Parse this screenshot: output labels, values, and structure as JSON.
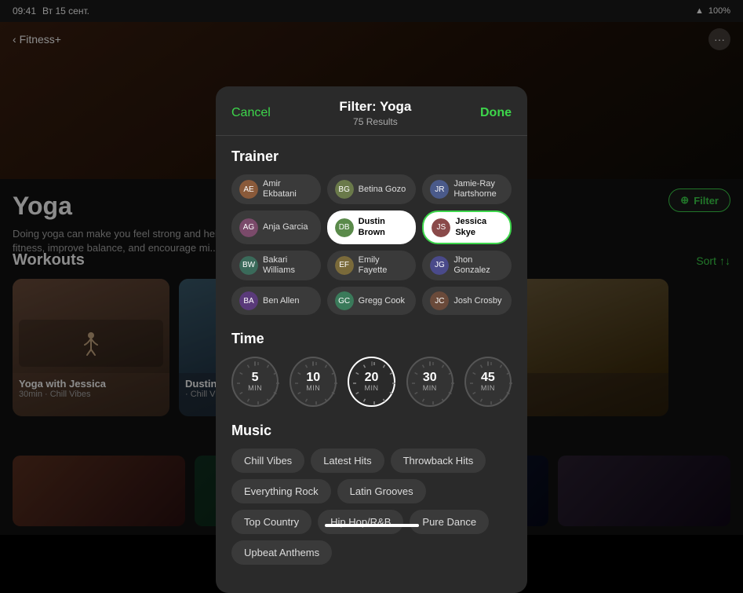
{
  "statusBar": {
    "time": "09:41",
    "date": "Вт 15 сент.",
    "signal": "●●●●",
    "wifi": "wifi",
    "battery": "100%"
  },
  "nav": {
    "back_label": "Fitness+",
    "more_icon": "···"
  },
  "yoga": {
    "title": "Yoga",
    "description": "Doing yoga can make you feel strong and help you increase overall fitness, improve balance, and encourage mi...",
    "filter_label": "Filter",
    "workouts_label": "Workouts",
    "sort_label": "Sort"
  },
  "modal": {
    "cancel_label": "Cancel",
    "title": "Filter: Yoga",
    "subtitle": "75 Results",
    "done_label": "Done",
    "trainer_section": "Trainer",
    "time_section": "Time",
    "music_section": "Music",
    "trainers": [
      {
        "name": "Amir Ekbatani",
        "color": "#8a5a3a",
        "initials": "AE",
        "selected": false
      },
      {
        "name": "Betina Gozo",
        "color": "#6a7a4a",
        "initials": "BG",
        "selected": false
      },
      {
        "name": "Jamie-Ray Hartshorne",
        "color": "#4a5a8a",
        "initials": "JR",
        "selected": false
      },
      {
        "name": "Anja Garcia",
        "color": "#7a4a6a",
        "initials": "AG",
        "selected": false
      },
      {
        "name": "Dustin Brown",
        "color": "#5a8a4a",
        "initials": "DB",
        "selected": true
      },
      {
        "name": "Jessica Skye",
        "color": "#8a4a4a",
        "initials": "JS",
        "selected": true,
        "highlighted": true
      },
      {
        "name": "Bakari Williams",
        "color": "#3a6a5a",
        "initials": "BW",
        "selected": false
      },
      {
        "name": "Emily Fayette",
        "color": "#7a6a3a",
        "initials": "EF",
        "selected": false
      },
      {
        "name": "Jhon Gonzalez",
        "color": "#4a4a8a",
        "initials": "JG",
        "selected": false
      },
      {
        "name": "Ben Allen",
        "color": "#5a3a7a",
        "initials": "BA",
        "selected": false
      },
      {
        "name": "Gregg Cook",
        "color": "#3a7a5a",
        "initials": "GC",
        "selected": false
      },
      {
        "name": "Josh Crosby",
        "color": "#6a4a3a",
        "initials": "JC",
        "selected": false
      }
    ],
    "times": [
      {
        "value": "5",
        "label": "MIN",
        "selected": false
      },
      {
        "value": "10",
        "label": "MIN",
        "selected": false
      },
      {
        "value": "20",
        "label": "MIN",
        "selected": true
      },
      {
        "value": "30",
        "label": "MIN",
        "selected": false
      },
      {
        "value": "45",
        "label": "MIN",
        "selected": false
      }
    ],
    "music_tags": [
      {
        "label": "Chill Vibes",
        "selected": false
      },
      {
        "label": "Latest Hits",
        "selected": false
      },
      {
        "label": "Throwback Hits",
        "selected": false
      },
      {
        "label": "Everything Rock",
        "selected": false
      },
      {
        "label": "Latin Grooves",
        "selected": false
      },
      {
        "label": "Top Country",
        "selected": false
      },
      {
        "label": "Hip Hop/R&B",
        "selected": false
      },
      {
        "label": "Pure Dance",
        "selected": false
      },
      {
        "label": "Upbeat Anthems",
        "selected": false
      }
    ]
  },
  "workoutCards": [
    {
      "name": "Yoga with Jessica",
      "sub": "30min · Chill Vibes"
    },
    {
      "name": "Dustin",
      "sub": "· Chill Vibes"
    }
  ],
  "icons": {
    "chevron_left": "‹",
    "filter_circle": "⊕",
    "sort_arrows": "↑↓"
  }
}
